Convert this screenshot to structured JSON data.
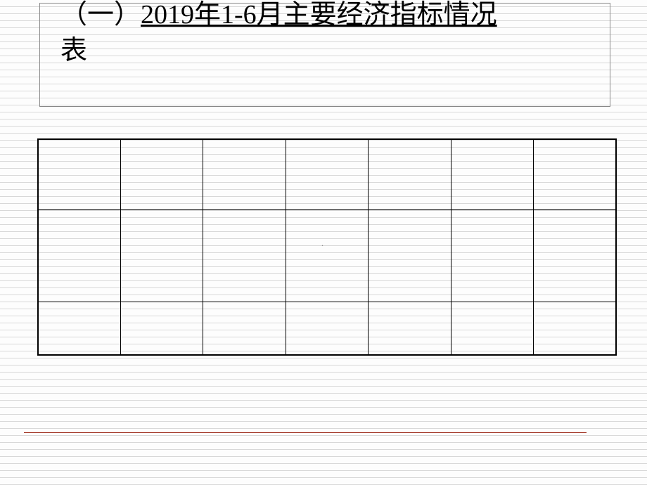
{
  "title": {
    "prefix": "（一）",
    "underlined": "2019年1-6月主要经济指标情况",
    "suffix": "表"
  },
  "table": {
    "rows": 3,
    "cols": 7,
    "cells": [
      [
        "",
        "",
        "",
        "",
        "",
        "",
        ""
      ],
      [
        "",
        "",
        "",
        "",
        "",
        "",
        ""
      ],
      [
        "",
        "",
        "",
        "",
        "",
        "",
        ""
      ]
    ]
  },
  "watermark_dot": "."
}
